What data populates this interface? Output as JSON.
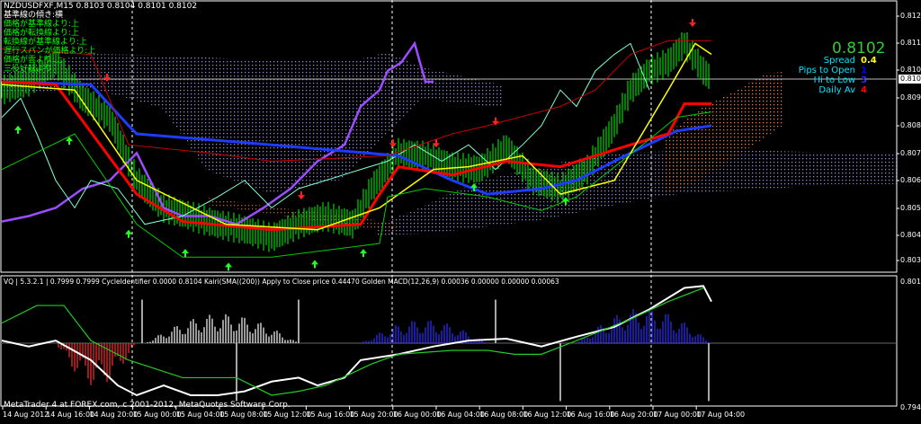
{
  "header": {
    "symbol_line": "NZDUSDFXF,M15  0.8103 0.8104 0.8101 0.8102",
    "ichimoku_status": [
      "基準線の傾き:横",
      "価格が基準線より:上",
      "価格が転換線より:上",
      "転換線が基準線より:上",
      "遅行スパンが価格より:上",
      "価格が雲より:上",
      "三役好転より..."
    ]
  },
  "info_panel": {
    "price": "0.8102",
    "rows": [
      {
        "label": "Spread",
        "value": "0.4",
        "color": "#ffff00"
      },
      {
        "label": "Pips to Open",
        "value": "1",
        "color": "#0000ff"
      },
      {
        "label": "Hi to Low",
        "value": "3",
        "color": "#3030ff"
      },
      {
        "label": "Daily Av",
        "value": "4",
        "color": "#ff0000"
      }
    ]
  },
  "price_axis": {
    "labels": [
      "0.8125",
      "0.8115",
      "0.8105",
      "0.8095",
      "0.8085",
      "0.8075",
      "0.8065",
      "0.8055",
      "0.8045",
      "0.8035"
    ],
    "current": "0.8102"
  },
  "subwindow": {
    "title": "VQ | 5.3.2.1 | 0.7999 0.7999  CycleIdentifier 0.0000 0.8104  Kairi(SMA((200)) Apply to Close price 0.44470  Golden MACD(12,26,9) 0.00036 0.00000 0.00000 0.00063",
    "top_label": "0.8013",
    "bottom_label": "0.7949"
  },
  "time_axis": {
    "labels": [
      "14 Aug 2012",
      "14 Aug 16:00",
      "14 Aug 20:00",
      "15 Aug 00:00",
      "15 Aug 04:00",
      "15 Aug 08:00",
      "15 Aug 12:00",
      "15 Aug 16:00",
      "15 Aug 20:00",
      "16 Aug 00:00",
      "16 Aug 04:00",
      "16 Aug 08:00",
      "16 Aug 12:00",
      "16 Aug 16:00",
      "16 Aug 20:00",
      "17 Aug 00:00",
      "17 Aug 04:00"
    ]
  },
  "footer": {
    "copyright": "MetaTrader 4 at FOREX.com, c 2001-2012, MetaQuotes Software Corp."
  },
  "chart_data": [
    {
      "type": "line",
      "title": "NZDUSDFXF,M15",
      "x_unit": "M15 bar index",
      "ylim": [
        0.803,
        0.813
      ],
      "series": [
        {
          "name": "price",
          "color": "#00ff00",
          "points": [
            [
              0,
              0.8098
            ],
            [
              10,
              0.8101
            ],
            [
              20,
              0.8108
            ],
            [
              30,
              0.8095
            ],
            [
              40,
              0.8088
            ],
            [
              50,
              0.8065
            ],
            [
              60,
              0.8055
            ],
            [
              70,
              0.8052
            ],
            [
              80,
              0.8049
            ],
            [
              90,
              0.8047
            ],
            [
              100,
              0.8044
            ],
            [
              110,
              0.8049
            ],
            [
              120,
              0.8052
            ],
            [
              130,
              0.8049
            ],
            [
              137,
              0.8062
            ],
            [
              147,
              0.8075
            ],
            [
              157,
              0.8074
            ],
            [
              167,
              0.807
            ],
            [
              177,
              0.8069
            ],
            [
              187,
              0.8077
            ],
            [
              197,
              0.8065
            ],
            [
              207,
              0.8062
            ],
            [
              217,
              0.8069
            ],
            [
              227,
              0.8085
            ],
            [
              233,
              0.8098
            ],
            [
              240,
              0.8105
            ],
            [
              247,
              0.8108
            ],
            [
              253,
              0.8115
            ],
            [
              260,
              0.8105
            ],
            [
              263,
              0.8102
            ]
          ]
        },
        {
          "name": "purple",
          "color": "#9b4dff",
          "points": [
            [
              0,
              0.805
            ],
            [
              10,
              0.8052
            ],
            [
              20,
              0.8055
            ],
            [
              30,
              0.8062
            ],
            [
              40,
              0.8065
            ],
            [
              50,
              0.8075
            ],
            [
              60,
              0.8055
            ],
            [
              67,
              0.8052
            ],
            [
              77,
              0.8052
            ],
            [
              87,
              0.8049
            ],
            [
              97,
              0.8055
            ],
            [
              107,
              0.8062
            ],
            [
              117,
              0.8072
            ],
            [
              127,
              0.8078
            ],
            [
              133,
              0.8092
            ],
            [
              140,
              0.8098
            ],
            [
              143,
              0.8105
            ],
            [
              148,
              0.8108
            ],
            [
              153,
              0.8115
            ],
            [
              157,
              0.8101
            ],
            [
              160,
              0.8101
            ]
          ]
        },
        {
          "name": "cyan",
          "color": "#7fffd4",
          "points": [
            [
              0,
              0.8088
            ],
            [
              7,
              0.8095
            ],
            [
              13,
              0.8082
            ],
            [
              20,
              0.8065
            ],
            [
              27,
              0.8055
            ],
            [
              33,
              0.8065
            ],
            [
              43,
              0.8062
            ],
            [
              53,
              0.8049
            ],
            [
              67,
              0.8052
            ],
            [
              80,
              0.8059
            ],
            [
              90,
              0.8065
            ],
            [
              100,
              0.8055
            ],
            [
              110,
              0.8062
            ],
            [
              120,
              0.8065
            ],
            [
              133,
              0.8069
            ],
            [
              143,
              0.8072
            ],
            [
              153,
              0.8078
            ],
            [
              163,
              0.8072
            ],
            [
              173,
              0.8078
            ],
            [
              183,
              0.8069
            ],
            [
              193,
              0.8078
            ],
            [
              200,
              0.8085
            ],
            [
              207,
              0.8098
            ],
            [
              213,
              0.8092
            ],
            [
              220,
              0.8105
            ],
            [
              227,
              0.8111
            ],
            [
              233,
              0.8115
            ],
            [
              240,
              0.8098
            ]
          ]
        },
        {
          "name": "blue",
          "color": "#1e3cff",
          "points": [
            [
              0,
              0.8101
            ],
            [
              33,
              0.81
            ],
            [
              47,
              0.8085
            ],
            [
              50,
              0.8082
            ],
            [
              100,
              0.8078
            ],
            [
              147,
              0.8074
            ],
            [
              167,
              0.8065
            ],
            [
              180,
              0.806
            ],
            [
              200,
              0.8062
            ],
            [
              213,
              0.8065
            ],
            [
              233,
              0.8075
            ],
            [
              250,
              0.8083
            ],
            [
              263,
              0.8085
            ]
          ]
        },
        {
          "name": "kijun-red",
          "color": "#ff0000",
          "points": [
            [
              0,
              0.8101
            ],
            [
              20,
              0.81
            ],
            [
              50,
              0.806
            ],
            [
              67,
              0.805
            ],
            [
              100,
              0.8047
            ],
            [
              133,
              0.8049
            ],
            [
              140,
              0.806
            ],
            [
              147,
              0.807
            ],
            [
              167,
              0.8067
            ],
            [
              187,
              0.8072
            ],
            [
              207,
              0.807
            ],
            [
              233,
              0.8078
            ],
            [
              247,
              0.8082
            ],
            [
              253,
              0.8093
            ],
            [
              263,
              0.8093
            ]
          ]
        },
        {
          "name": "yellow",
          "color": "#ffff00",
          "points": [
            [
              0,
              0.81
            ],
            [
              27,
              0.8098
            ],
            [
              50,
              0.8065
            ],
            [
              83,
              0.8049
            ],
            [
              117,
              0.8047
            ],
            [
              140,
              0.8055
            ],
            [
              160,
              0.8069
            ],
            [
              173,
              0.807
            ],
            [
              193,
              0.8074
            ],
            [
              207,
              0.806
            ],
            [
              227,
              0.8065
            ],
            [
              247,
              0.8098
            ],
            [
              257,
              0.8115
            ],
            [
              263,
              0.8111
            ]
          ]
        },
        {
          "name": "upper-red",
          "color": "#cc0000",
          "points": [
            [
              0,
              0.8113
            ],
            [
              33,
              0.8111
            ],
            [
              47,
              0.8078
            ],
            [
              77,
              0.8075
            ],
            [
              100,
              0.8072
            ],
            [
              143,
              0.8074
            ],
            [
              167,
              0.8082
            ],
            [
              180,
              0.8085
            ],
            [
              207,
              0.8092
            ],
            [
              220,
              0.8098
            ],
            [
              233,
              0.8111
            ],
            [
              247,
              0.8116
            ],
            [
              263,
              0.8116
            ]
          ]
        },
        {
          "name": "lower-green",
          "color": "#00cc00",
          "points": [
            [
              0,
              0.8069
            ],
            [
              27,
              0.8082
            ],
            [
              50,
              0.8049
            ],
            [
              67,
              0.8037
            ],
            [
              100,
              0.8037
            ],
            [
              140,
              0.8042
            ],
            [
              143,
              0.8059
            ],
            [
              157,
              0.8062
            ],
            [
              180,
              0.8059
            ],
            [
              200,
              0.8054
            ],
            [
              213,
              0.8059
            ],
            [
              240,
              0.808
            ],
            [
              250,
              0.8088
            ],
            [
              263,
              0.809
            ]
          ]
        }
      ],
      "arrows": {
        "sell": [
          [
            39,
            0.8102
          ],
          [
            111,
            0.8059
          ],
          [
            145,
            0.8078
          ],
          [
            161,
            0.8078
          ],
          [
            183,
            0.8086
          ],
          [
            256,
            0.8122
          ]
        ],
        "buy": [
          [
            6,
            0.8084
          ],
          [
            25,
            0.808
          ],
          [
            47,
            0.8046
          ],
          [
            68,
            0.8039
          ],
          [
            84,
            0.8034
          ],
          [
            116,
            0.8035
          ],
          [
            134,
            0.8039
          ],
          [
            175,
            0.8063
          ],
          [
            209,
            0.8058
          ]
        ]
      }
    },
    {
      "type": "line",
      "title": "VQ / CycleIdentifier / Kairi / Golden MACD",
      "ylim": [
        0.7949,
        0.8013
      ],
      "series": [
        {
          "name": "vq-white",
          "color": "#ffffff",
          "points": [
            [
              0,
              0.7983
            ],
            [
              10,
              0.798
            ],
            [
              20,
              0.7983
            ],
            [
              33,
              0.7973
            ],
            [
              43,
              0.796
            ],
            [
              50,
              0.7955
            ],
            [
              60,
              0.796
            ],
            [
              70,
              0.7955
            ],
            [
              80,
              0.7955
            ],
            [
              90,
              0.7957
            ],
            [
              100,
              0.7962
            ],
            [
              110,
              0.7964
            ],
            [
              117,
              0.796
            ],
            [
              127,
              0.7964
            ],
            [
              133,
              0.7973
            ],
            [
              147,
              0.7976
            ],
            [
              160,
              0.798
            ],
            [
              173,
              0.7983
            ],
            [
              187,
              0.7984
            ],
            [
              200,
              0.798
            ],
            [
              213,
              0.7985
            ],
            [
              227,
              0.799
            ],
            [
              240,
              0.7999
            ],
            [
              253,
              0.801
            ],
            [
              260,
              0.8011
            ],
            [
              263,
              0.8003
            ]
          ]
        },
        {
          "name": "macd-green",
          "color": "#22cc22",
          "points": [
            [
              0,
              0.7992
            ],
            [
              13,
              0.8001
            ],
            [
              23,
              0.8001
            ],
            [
              33,
              0.7983
            ],
            [
              47,
              0.7973
            ],
            [
              67,
              0.7964
            ],
            [
              87,
              0.7964
            ],
            [
              100,
              0.7955
            ],
            [
              110,
              0.7957
            ],
            [
              120,
              0.796
            ],
            [
              137,
              0.7971
            ],
            [
              147,
              0.7976
            ],
            [
              167,
              0.7978
            ],
            [
              180,
              0.7978
            ],
            [
              190,
              0.7976
            ],
            [
              200,
              0.7976
            ],
            [
              213,
              0.7983
            ],
            [
              233,
              0.7994
            ],
            [
              247,
              0.8003
            ],
            [
              260,
              0.801
            ]
          ]
        }
      ],
      "histogram": [
        {
          "from": 20,
          "to": 50,
          "color": "#ff3030",
          "peak": -0.0022
        },
        {
          "from": 53,
          "to": 110,
          "color": "#ffffff",
          "peak": 0.0015
        },
        {
          "from": 133,
          "to": 180,
          "color": "#3030ff",
          "peak": 0.0012
        },
        {
          "from": 213,
          "to": 263,
          "color": "#3030ff",
          "peak": 0.0018
        }
      ],
      "spikes": [
        [
          52,
          0.8004
        ],
        [
          87,
          0.7952
        ],
        [
          110,
          0.8004
        ],
        [
          183,
          0.8004
        ],
        [
          207,
          0.7952
        ],
        [
          262,
          0.7952
        ]
      ]
    }
  ]
}
